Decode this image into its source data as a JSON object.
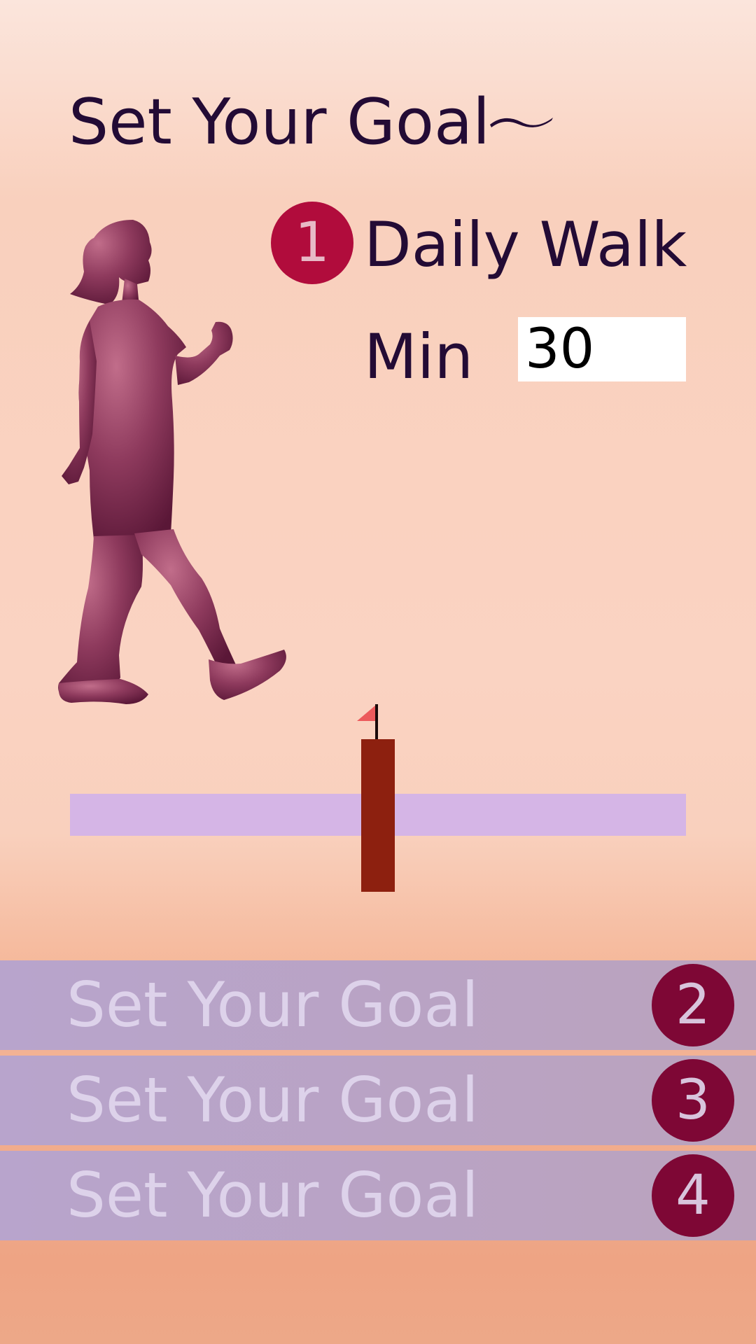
{
  "header": {
    "title": "Set Your Goal",
    "title_icon": "tilde-icon"
  },
  "illustration": {
    "icon": "walking-woman-icon",
    "color": "#8a3558"
  },
  "goal": {
    "number": "1",
    "name": "Daily Walk",
    "unit_label": "Min",
    "minutes_value": "30",
    "badge_color": "#b10c3c"
  },
  "slider": {
    "track_color": "#d5b5e6",
    "handle_color": "#8d200f",
    "flag_icon": "flag-icon",
    "flag_color": "#ec5a5c",
    "level": 0.5
  },
  "goal_rows": [
    {
      "label": "Set Your Goal",
      "number": "2"
    },
    {
      "label": "Set Your Goal",
      "number": "3"
    },
    {
      "label": "Set Your Goal",
      "number": "4"
    }
  ],
  "colors": {
    "text_dark": "#230b35",
    "row_text": "#ddd2ea",
    "row_badge": "#7e0735"
  }
}
